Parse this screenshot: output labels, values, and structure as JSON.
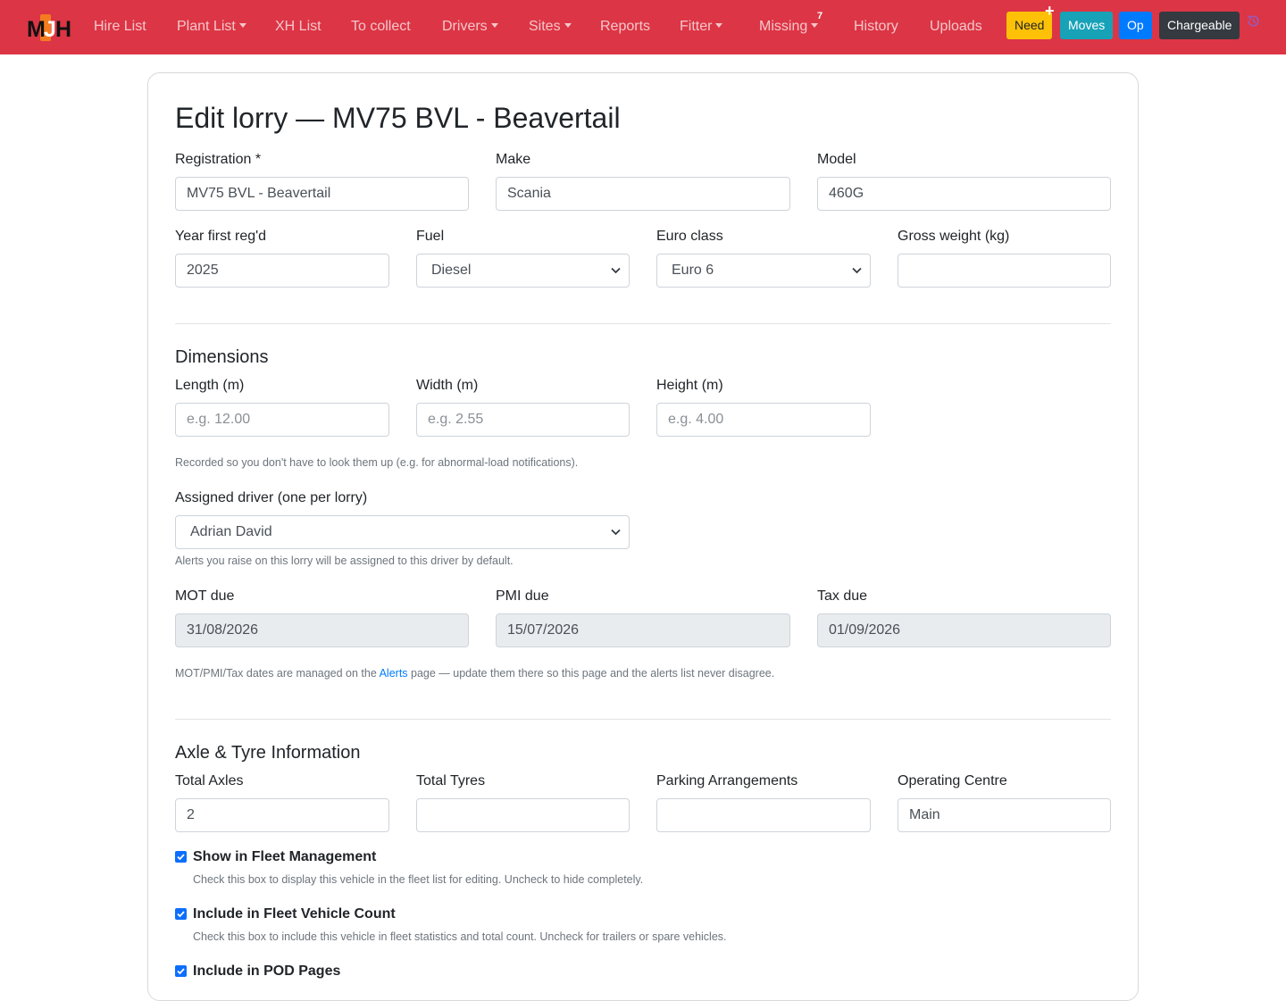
{
  "navbar": {
    "brand": "MJH",
    "items": [
      {
        "label": "Hire List",
        "dropdown": false
      },
      {
        "label": "Plant List",
        "dropdown": true
      },
      {
        "label": "XH List",
        "dropdown": false
      },
      {
        "label": "To collect",
        "dropdown": false
      },
      {
        "label": "Drivers",
        "dropdown": true
      },
      {
        "label": "Sites",
        "dropdown": true
      },
      {
        "label": "Reports",
        "dropdown": false
      },
      {
        "label": "Fitter",
        "dropdown": true
      },
      {
        "label": "Missing",
        "dropdown": true
      },
      {
        "label": "History",
        "dropdown": false
      },
      {
        "label": "Uploads",
        "dropdown": false
      }
    ],
    "missing_count": "7",
    "buttons": {
      "need": "Need",
      "moves": "Moves",
      "op": "Op",
      "chargeable": "Chargeable"
    },
    "colors": {
      "bar": "#dc3545",
      "need": "#ffc107",
      "moves": "#17a2b8",
      "op": "#007bff",
      "chargeable": "#343a40"
    }
  },
  "page": {
    "title": "Edit lorry — MV75 BVL - Beavertail"
  },
  "basic": {
    "registration": {
      "label": "Registration *",
      "value": "MV75 BVL - Beavertail"
    },
    "make": {
      "label": "Make",
      "value": "Scania"
    },
    "model": {
      "label": "Model",
      "value": "460G"
    },
    "year": {
      "label": "Year first reg'd",
      "value": "2025"
    },
    "fuel": {
      "label": "Fuel",
      "value": "Diesel"
    },
    "euro_class": {
      "label": "Euro class",
      "value": "Euro 6"
    },
    "gross_weight": {
      "label": "Gross weight (kg)",
      "value": ""
    }
  },
  "dimensions": {
    "heading": "Dimensions",
    "length": {
      "label": "Length (m)",
      "placeholder": "e.g. 12.00"
    },
    "width": {
      "label": "Width (m)",
      "placeholder": "e.g. 2.55"
    },
    "height": {
      "label": "Height (m)",
      "placeholder": "e.g. 4.00"
    },
    "help": "Recorded so you don't have to look them up (e.g. for abnormal-load notifications)."
  },
  "driver": {
    "label": "Assigned driver (one per lorry)",
    "value": "Adrian David",
    "help": "Alerts you raise on this lorry will be assigned to this driver by default."
  },
  "dues": {
    "mot": {
      "label": "MOT due",
      "value": "31/08/2026"
    },
    "pmi": {
      "label": "PMI due",
      "value": "15/07/2026"
    },
    "tax": {
      "label": "Tax due",
      "value": "01/09/2026"
    },
    "help_prefix": "MOT/PMI/Tax dates are managed on the ",
    "help_link": "Alerts",
    "help_suffix": " page — update them there so this page and the alerts list never disagree."
  },
  "axle": {
    "heading": "Axle & Tyre Information",
    "total_axles": {
      "label": "Total Axles",
      "value": "2"
    },
    "total_tyres": {
      "label": "Total Tyres",
      "value": ""
    },
    "parking": {
      "label": "Parking Arrangements",
      "value": ""
    },
    "operating_centre": {
      "label": "Operating Centre",
      "value": "Main"
    }
  },
  "options": [
    {
      "label": "Show in Fleet Management",
      "checked": true,
      "help": "Check this box to display this vehicle in the fleet list for editing. Uncheck to hide completely."
    },
    {
      "label": "Include in Fleet Vehicle Count",
      "checked": true,
      "help": "Check this box to include this vehicle in fleet statistics and total count. Uncheck for trailers or spare vehicles."
    },
    {
      "label": "Include in POD Pages",
      "checked": true,
      "help": ""
    }
  ]
}
